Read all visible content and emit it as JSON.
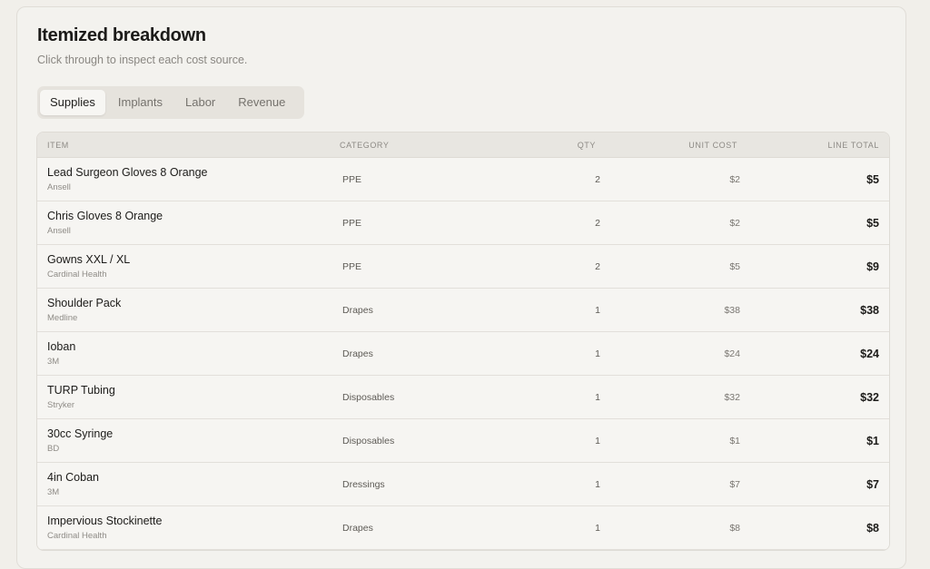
{
  "header": {
    "title": "Itemized breakdown",
    "subtitle": "Click through to inspect each cost source."
  },
  "tabs": [
    {
      "label": "Supplies",
      "active": true
    },
    {
      "label": "Implants",
      "active": false
    },
    {
      "label": "Labor",
      "active": false
    },
    {
      "label": "Revenue",
      "active": false
    }
  ],
  "table": {
    "columns": {
      "item": "ITEM",
      "category": "CATEGORY",
      "qty": "QTY",
      "unit_cost": "UNIT COST",
      "line_total": "LINE TOTAL"
    },
    "rows": [
      {
        "name": "Lead Surgeon Gloves 8 Orange",
        "vendor": "Ansell",
        "category": "PPE",
        "qty": "2",
        "unit_cost": "$2",
        "line_total": "$5"
      },
      {
        "name": "Chris Gloves 8 Orange",
        "vendor": "Ansell",
        "category": "PPE",
        "qty": "2",
        "unit_cost": "$2",
        "line_total": "$5"
      },
      {
        "name": "Gowns XXL / XL",
        "vendor": "Cardinal Health",
        "category": "PPE",
        "qty": "2",
        "unit_cost": "$5",
        "line_total": "$9"
      },
      {
        "name": "Shoulder Pack",
        "vendor": "Medline",
        "category": "Drapes",
        "qty": "1",
        "unit_cost": "$38",
        "line_total": "$38"
      },
      {
        "name": "Ioban",
        "vendor": "3M",
        "category": "Drapes",
        "qty": "1",
        "unit_cost": "$24",
        "line_total": "$24"
      },
      {
        "name": "TURP Tubing",
        "vendor": "Stryker",
        "category": "Disposables",
        "qty": "1",
        "unit_cost": "$32",
        "line_total": "$32"
      },
      {
        "name": "30cc Syringe",
        "vendor": "BD",
        "category": "Disposables",
        "qty": "1",
        "unit_cost": "$1",
        "line_total": "$1"
      },
      {
        "name": "4in Coban",
        "vendor": "3M",
        "category": "Dressings",
        "qty": "1",
        "unit_cost": "$7",
        "line_total": "$7"
      },
      {
        "name": "Impervious Stockinette",
        "vendor": "Cardinal Health",
        "category": "Drapes",
        "qty": "1",
        "unit_cost": "$8",
        "line_total": "$8"
      }
    ]
  }
}
